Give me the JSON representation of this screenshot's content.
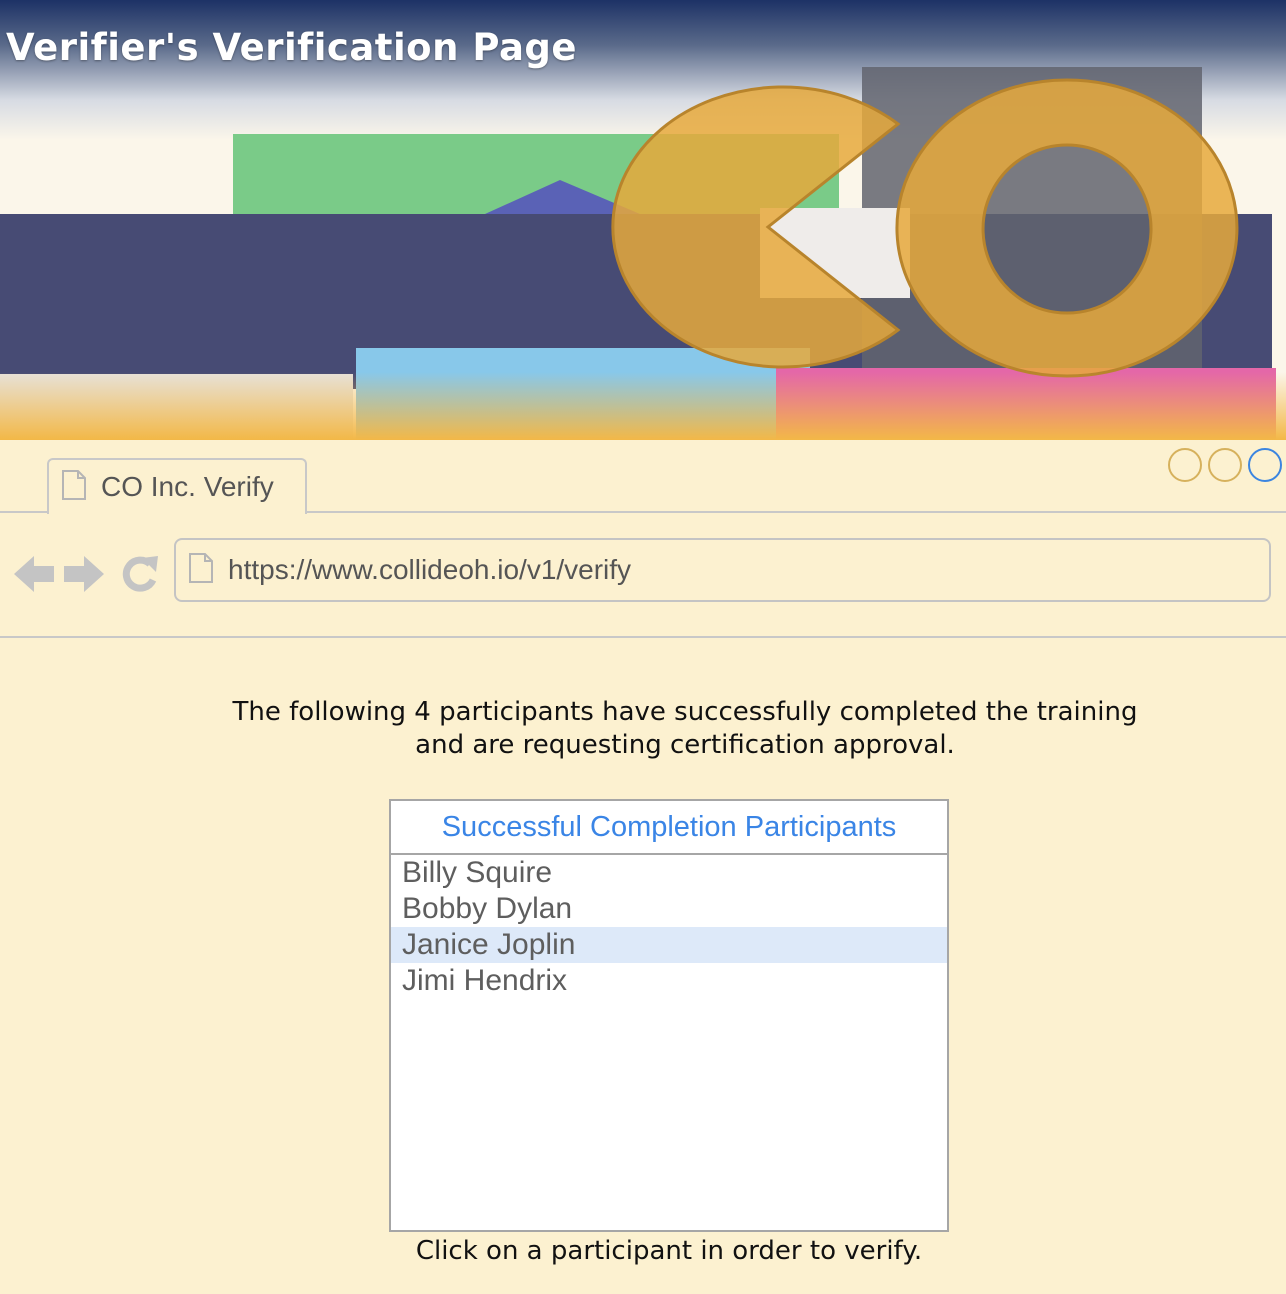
{
  "header": {
    "title": "Verifier's Verification Page"
  },
  "browser": {
    "tab_label": "CO Inc. Verify",
    "url": "https://www.collideoh.io/v1/verify",
    "window_controls": [
      "minimize",
      "maximize",
      "close"
    ]
  },
  "content": {
    "intro_line1": "The following 4 participants have successfully completed the training",
    "intro_line2": "and are requesting certification approval.",
    "list_header": "Successful Completion Participants",
    "participants": [
      {
        "name": "Billy Squire",
        "selected": false
      },
      {
        "name": "Bobby Dylan",
        "selected": false
      },
      {
        "name": "Janice Joplin",
        "selected": true
      },
      {
        "name": "Jimi Hendrix",
        "selected": false
      }
    ],
    "hint": "Click on a participant in order to verify."
  },
  "colors": {
    "page_background": "#fcf1d0",
    "list_header_text": "#3a85e6",
    "selected_row": "#dde9f9",
    "logo_gold": "#e6a93c",
    "navy": "#474b74"
  },
  "icons": [
    "page-icon",
    "back-arrow-icon",
    "forward-arrow-icon",
    "reload-icon"
  ]
}
